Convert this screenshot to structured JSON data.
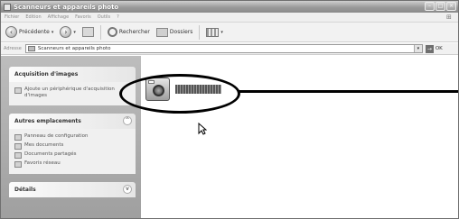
{
  "window": {
    "title": "Scanneurs et appareils photo"
  },
  "menu": [
    "Fichier",
    "Edition",
    "Affichage",
    "Favoris",
    "Outils",
    "?"
  ],
  "toolbar": {
    "back_label": "Précédente",
    "search_label": "Rechercher",
    "folders_label": "Dossiers"
  },
  "address": {
    "label": "Adresse",
    "value": "Scanneurs et appareils photo",
    "go_label": "OK"
  },
  "taskpane": {
    "panels": [
      {
        "title": "Acquisition d'images",
        "items": [
          "Ajoute un périphérique d'acquisition d'images"
        ]
      },
      {
        "title": "Autres emplacements",
        "items": [
          "Panneau de configuration",
          "Mes documents",
          "Documents partagés",
          "Favoris réseau"
        ]
      },
      {
        "title": "Détails",
        "items": []
      }
    ]
  },
  "icons": {
    "device": "camera-icon",
    "back": "back-arrow-icon",
    "forward": "forward-arrow-icon",
    "up": "folder-up-icon",
    "search": "search-icon",
    "folders": "folders-icon",
    "views": "views-icon"
  }
}
